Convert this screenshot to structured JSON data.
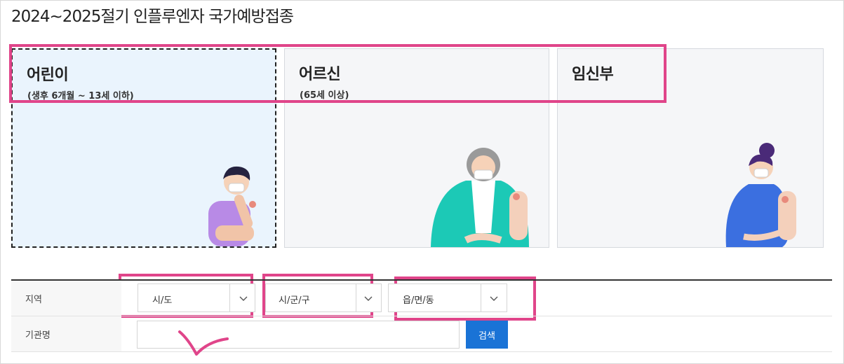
{
  "page": {
    "title": "2024~2025절기 인플루엔자 국가예방접종"
  },
  "categories": [
    {
      "title": "어린이",
      "subtitle": "(생후 6개월 ~ 13세 이하)",
      "selected": true
    },
    {
      "title": "어르신",
      "subtitle": "(65세 이상)",
      "selected": false
    },
    {
      "title": "임신부",
      "subtitle": "",
      "selected": false
    }
  ],
  "form": {
    "region_label": "지역",
    "sido": {
      "value": "시/도"
    },
    "sigungu": {
      "value": "시/군/구"
    },
    "eupmyeondong": {
      "value": "읍/면/동"
    },
    "org_label": "기관명",
    "org_input": {
      "value": "",
      "placeholder": ""
    },
    "search_label": "검색"
  },
  "colors": {
    "annotation": "#e0458a",
    "search_button": "#1a73d6",
    "selected_card_bg": "#eaf4fd"
  }
}
